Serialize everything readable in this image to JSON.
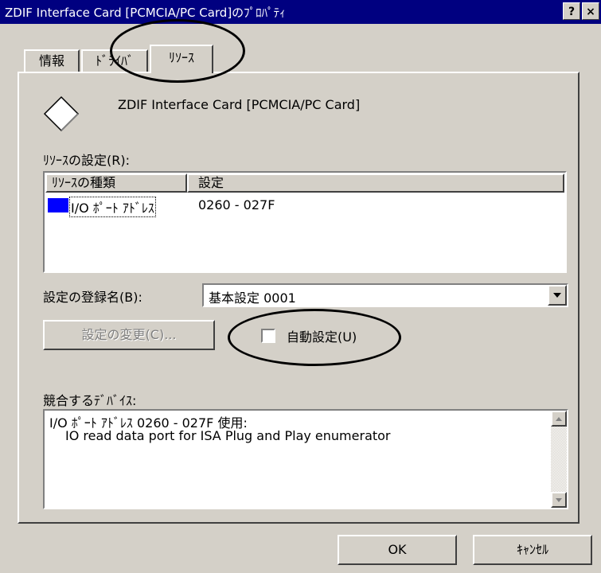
{
  "window": {
    "title": "ZDIF Interface Card [PCMCIA/PC Card]のﾌﾟﾛﾊﾟﾃｨ",
    "help_label": "?",
    "close_label": "×"
  },
  "tabs": [
    {
      "label": "情報"
    },
    {
      "label": "ﾄﾞﾗｲﾊﾞ"
    },
    {
      "label": "ﾘｿｰｽ"
    }
  ],
  "device": {
    "name": "ZDIF Interface Card [PCMCIA/PC Card]"
  },
  "resources": {
    "section_label": "ﾘｿｰｽの設定(R):",
    "columns": [
      "ﾘｿｰｽの種類",
      "設定"
    ],
    "rows": [
      {
        "type": "I/O ﾎﾟｰﾄ ｱﾄﾞﾚｽ",
        "setting": "0260 - 027F"
      }
    ]
  },
  "config": {
    "label": "設定の登録名(B):",
    "value": "基本設定 0001",
    "change_button": "設定の変更(C)...",
    "auto_label": "自動設定(U)",
    "auto_checked": false
  },
  "conflicts": {
    "label": "競合するﾃﾞﾊﾞｲｽ:",
    "line1": "I/O ﾎﾟｰﾄ ｱﾄﾞﾚｽ 0260 - 027F 使用:",
    "line2": "IO read data port for ISA Plug and Play enumerator"
  },
  "footer": {
    "ok": "OK",
    "cancel": "ｷｬﾝｾﾙ"
  }
}
